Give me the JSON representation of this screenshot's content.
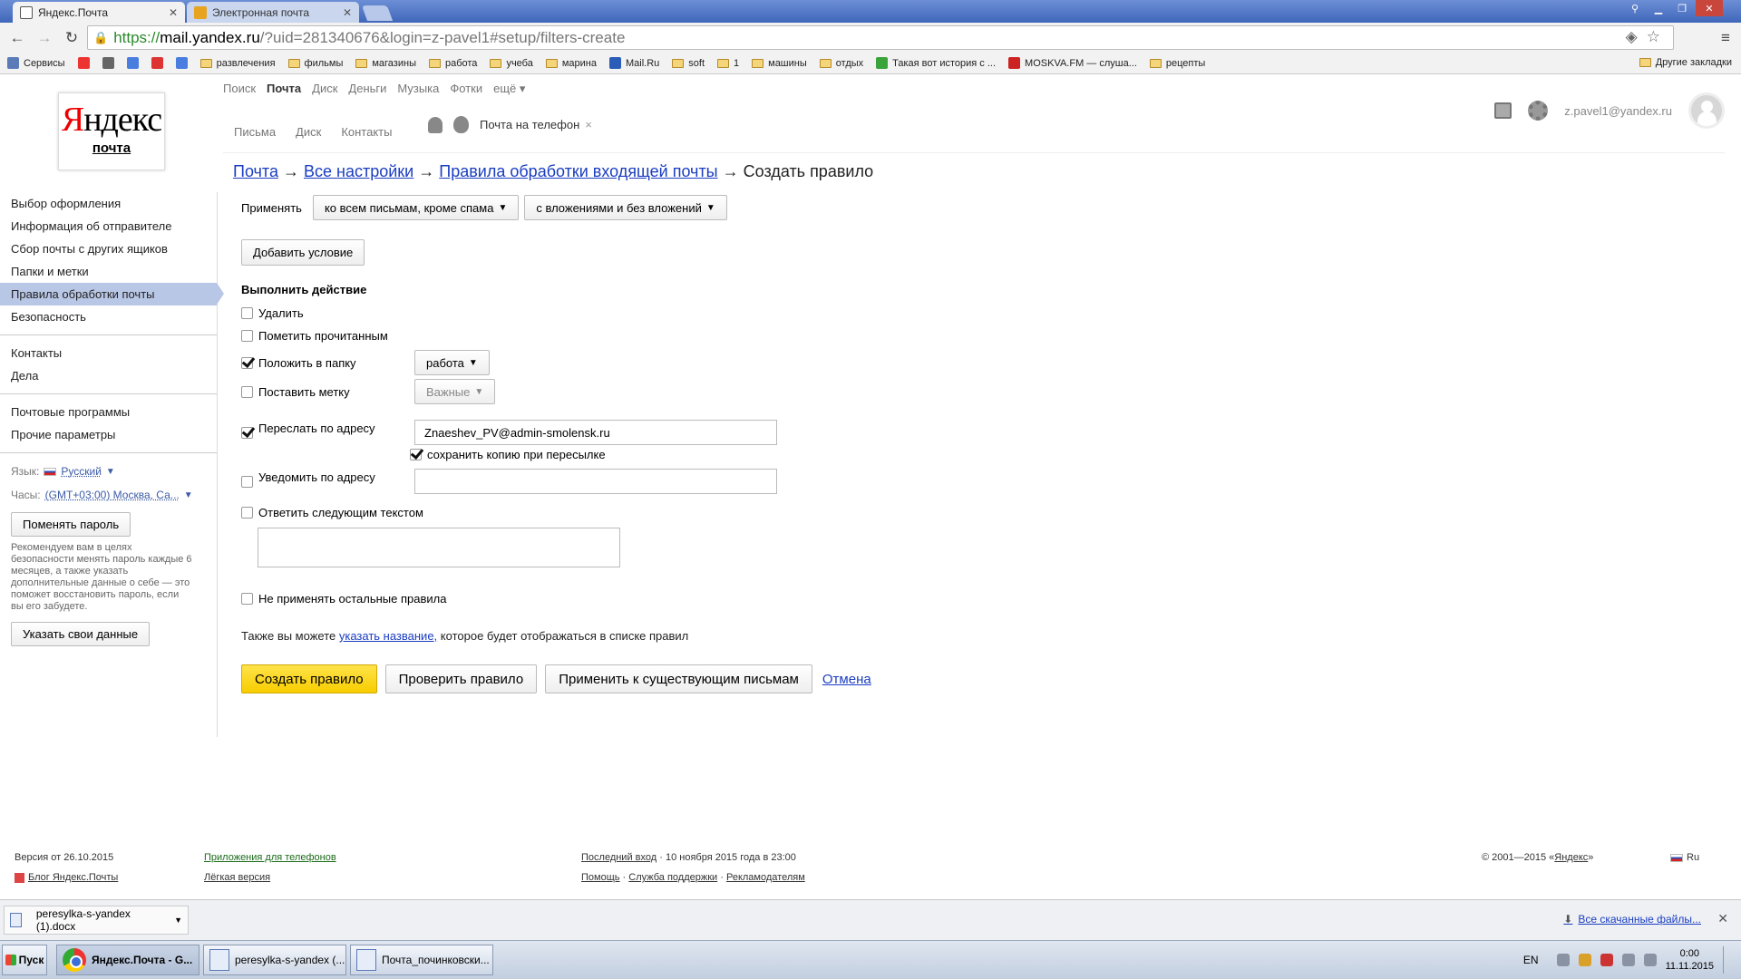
{
  "browser": {
    "tabs": [
      {
        "title": "Яндекс.Почта",
        "active": true
      },
      {
        "title": "Электронная почта",
        "active": false
      }
    ],
    "url": {
      "scheme": "https://",
      "host": "mail.yandex.ru",
      "path": "/?uid=281340676&login=z-pavel1#setup/filters-create"
    },
    "bookmarks": [
      {
        "label": "Сервисы",
        "icon": "apps-icon"
      },
      {
        "label": "",
        "icon": "yandex-icon"
      },
      {
        "label": "",
        "icon": "reader-icon"
      },
      {
        "label": "",
        "icon": "google-icon"
      },
      {
        "label": "",
        "icon": "pocket-icon"
      },
      {
        "label": "",
        "icon": "translate-icon"
      },
      {
        "label": "развлечения",
        "icon": "folder-icon"
      },
      {
        "label": "фильмы",
        "icon": "folder-icon"
      },
      {
        "label": "магазины",
        "icon": "folder-icon"
      },
      {
        "label": "работа",
        "icon": "folder-icon"
      },
      {
        "label": "учеба",
        "icon": "folder-icon"
      },
      {
        "label": "марина",
        "icon": "folder-icon"
      },
      {
        "label": "Mail.Ru",
        "icon": "mailru-icon"
      },
      {
        "label": "soft",
        "icon": "folder-icon"
      },
      {
        "label": "1",
        "icon": "folder-icon"
      },
      {
        "label": "машины",
        "icon": "folder-icon"
      },
      {
        "label": "отдых",
        "icon": "folder-icon"
      },
      {
        "label": "Такая вот история с ...",
        "icon": "green-f-icon"
      },
      {
        "label": "MOSKVA.FM — слуша...",
        "icon": "moskva-icon"
      },
      {
        "label": "рецепты",
        "icon": "folder-icon"
      }
    ],
    "other_bookmarks": "Другие закладки"
  },
  "logo": {
    "title": "Яндекс",
    "subtitle": "почта"
  },
  "header": {
    "services": [
      "Поиск",
      "Почта",
      "Диск",
      "Деньги",
      "Музыка",
      "Фотки",
      "ещё ▾"
    ],
    "current_service": "Почта",
    "subnav": [
      "Письма",
      "Диск",
      "Контакты"
    ],
    "phone_promo": "Почта на телефон",
    "user_email": "z.pavel1@yandex.ru"
  },
  "sidebar": {
    "group1": [
      "Выбор оформления",
      "Информация об отправителе",
      "Сбор почты с других ящиков",
      "Папки и метки",
      "Правила обработки почты",
      "Безопасность"
    ],
    "active_index": 4,
    "group2": [
      "Контакты",
      "Дела"
    ],
    "group3": [
      "Почтовые программы",
      "Прочие параметры"
    ],
    "language_label": "Язык:",
    "language_value": "Русский",
    "clock_label": "Часы:",
    "clock_value": "(GMT+03:00) Москва, Са...",
    "change_password": "Поменять пароль",
    "note": "Рекомендуем вам в целях безопасности менять пароль каждые 6 месяцев, а также указать дополнительные данные о себе — это поможет восстановить пароль, если вы его забудете.",
    "your_data": "Указать свои данные"
  },
  "breadcrumb": {
    "items": [
      "Почта",
      "Все настройки",
      "Правила обработки входящей почты"
    ],
    "current": "Создать правило",
    "sep": "→"
  },
  "rule": {
    "apply_label": "Применять",
    "apply_scope": "ко всем письмам, кроме спама",
    "apply_attachments": "с вложениями и без вложений",
    "add_condition": "Добавить условие",
    "actions_title": "Выполнить действие",
    "actions": [
      {
        "label": "Удалить",
        "checked": false
      },
      {
        "label": "Пометить прочитанным",
        "checked": false
      },
      {
        "label": "Положить в папку",
        "checked": true,
        "select": "работа"
      },
      {
        "label": "Поставить метку",
        "checked": false,
        "select": "Важные"
      },
      {
        "label": "Переслать по адресу",
        "checked": true,
        "value": "Znaeshev_PV@admin-smolensk.ru",
        "keep_copy_label": "сохранить копию при пересылке",
        "keep_copy": true
      },
      {
        "label": "Уведомить по адресу",
        "checked": false,
        "value": ""
      },
      {
        "label": "Ответить следующим текстом",
        "checked": false,
        "value": ""
      }
    ],
    "dont_apply_others": {
      "label": "Не применять остальные правила",
      "checked": false
    },
    "name_hint_pre": "Также вы можете",
    "name_hint_link": "указать название,",
    "name_hint_post": "которое будет отображаться в списке правил",
    "buttons": {
      "create": "Создать правило",
      "check": "Проверить правило",
      "apply_existing": "Применить к существующим письмам",
      "cancel": "Отмена"
    }
  },
  "footer": {
    "version": "Версия от 26.10.2015",
    "blog": "Блог Яндекс.Почты",
    "apps": "Приложения для телефонов",
    "lite": "Лёгкая версия",
    "last_login_link": "Последний вход",
    "last_login_value": "· 10 ноября 2015 года в 23:00",
    "help": "Помощь",
    "support": "Служба поддержки",
    "ads": "Рекламодателям",
    "copyright_pre": "© 2001—2015 «",
    "copyright_link": "Яндекс",
    "copyright_post": "»",
    "lang": "Ru"
  },
  "downloads": {
    "file": "peresylka-s-yandex (1).docx",
    "all": "Все скачанные файлы..."
  },
  "taskbar": {
    "start": "Пуск",
    "tasks": [
      "Яндекс.Почта - G...",
      "peresylka-s-yandex (...",
      "Почта_починковски..."
    ],
    "lang": "EN",
    "time": "0:00",
    "date": "11.11.2015"
  }
}
